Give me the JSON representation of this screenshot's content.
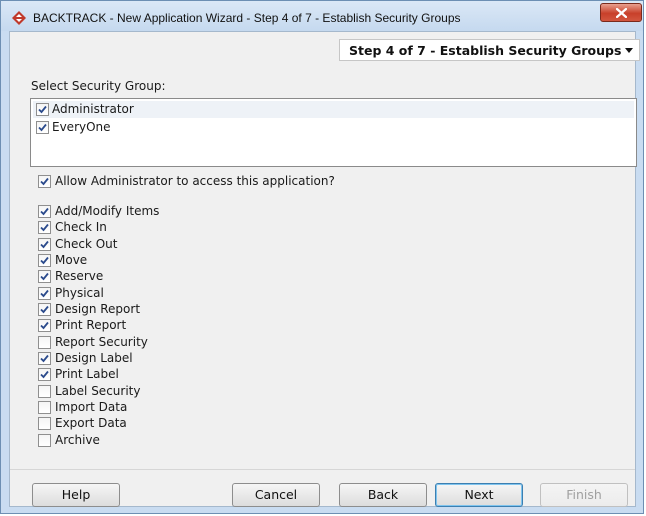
{
  "window": {
    "title": "BACKTRACK - New Application Wizard - Step 4 of 7 - Establish Security Groups",
    "close_icon": "close-icon"
  },
  "step_select": {
    "value": "Step 4 of 7 - Establish Security Groups"
  },
  "security_group": {
    "label": "Select Security Group:",
    "items": [
      {
        "label": "Administrator",
        "checked": true
      },
      {
        "label": "EveryOne",
        "checked": true
      }
    ]
  },
  "allow_admin": {
    "label": "Allow Administrator to access this application?",
    "checked": true
  },
  "permissions": [
    {
      "label": "Add/Modify Items",
      "checked": true
    },
    {
      "label": "Check In",
      "checked": true
    },
    {
      "label": "Check Out",
      "checked": true
    },
    {
      "label": "Move",
      "checked": true
    },
    {
      "label": "Reserve",
      "checked": true
    },
    {
      "label": "Physical",
      "checked": true
    },
    {
      "label": "Design Report",
      "checked": true
    },
    {
      "label": "Print Report",
      "checked": true
    },
    {
      "label": "Report Security",
      "checked": false
    },
    {
      "label": "Design Label",
      "checked": true
    },
    {
      "label": "Print Label",
      "checked": true
    },
    {
      "label": "Label Security",
      "checked": false
    },
    {
      "label": "Import Data",
      "checked": false
    },
    {
      "label": "Export Data",
      "checked": false
    },
    {
      "label": "Archive",
      "checked": false
    }
  ],
  "buttons": {
    "help": "Help",
    "cancel": "Cancel",
    "back": "Back",
    "next": "Next",
    "finish": "Finish"
  },
  "colors": {
    "check": "#2a4a8c",
    "close_red": "#c8402a"
  }
}
